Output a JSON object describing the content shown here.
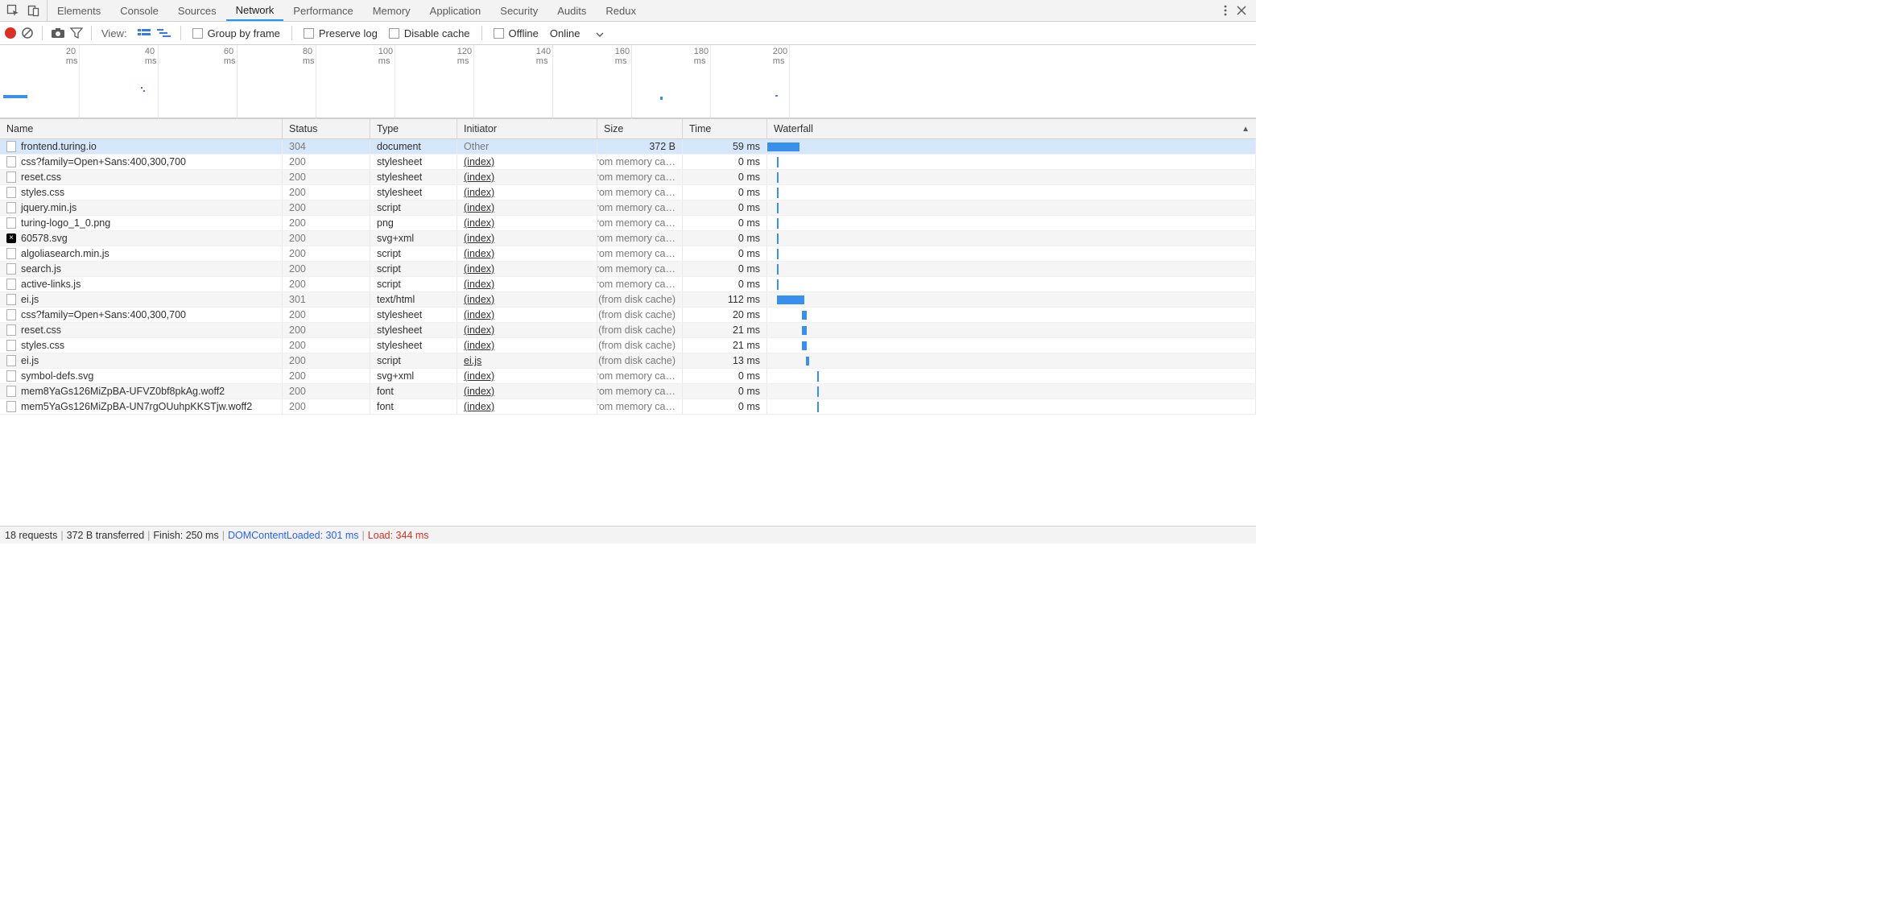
{
  "tabs": [
    "Elements",
    "Console",
    "Sources",
    "Network",
    "Performance",
    "Memory",
    "Application",
    "Security",
    "Audits",
    "Redux"
  ],
  "activeTab": "Network",
  "toolbar": {
    "viewLabel": "View:",
    "groupByFrame": "Group by frame",
    "preserveLog": "Preserve log",
    "disableCache": "Disable cache",
    "offline": "Offline",
    "online": "Online"
  },
  "overview": {
    "ticks": [
      "20 ms",
      "40 ms",
      "60 ms",
      "80 ms",
      "100 ms",
      "120 ms",
      "140 ms",
      "160 ms",
      "180 ms",
      "200 ms"
    ]
  },
  "columns": [
    "Name",
    "Status",
    "Type",
    "Initiator",
    "Size",
    "Time",
    "Waterfall"
  ],
  "rows": [
    {
      "name": "frontend.turing.io",
      "status": "304",
      "type": "document",
      "initiator": "Other",
      "initiatorLink": false,
      "size": "372 B",
      "sizeMuted": false,
      "time": "59 ms",
      "icon": "doc",
      "wf": {
        "start": 0,
        "width": 40,
        "thick": true
      }
    },
    {
      "name": "css?family=Open+Sans:400,300,700",
      "status": "200",
      "type": "stylesheet",
      "initiator": "(index)",
      "initiatorLink": true,
      "size": "(from memory ca…",
      "sizeMuted": true,
      "time": "0 ms",
      "icon": "doc",
      "wf": {
        "start": 12,
        "tick": true
      }
    },
    {
      "name": "reset.css",
      "status": "200",
      "type": "stylesheet",
      "initiator": "(index)",
      "initiatorLink": true,
      "size": "(from memory ca…",
      "sizeMuted": true,
      "time": "0 ms",
      "icon": "doc",
      "wf": {
        "start": 12,
        "tick": true
      }
    },
    {
      "name": "styles.css",
      "status": "200",
      "type": "stylesheet",
      "initiator": "(index)",
      "initiatorLink": true,
      "size": "(from memory ca…",
      "sizeMuted": true,
      "time": "0 ms",
      "icon": "doc",
      "wf": {
        "start": 12,
        "tick": true
      }
    },
    {
      "name": "jquery.min.js",
      "status": "200",
      "type": "script",
      "initiator": "(index)",
      "initiatorLink": true,
      "size": "(from memory ca…",
      "sizeMuted": true,
      "time": "0 ms",
      "icon": "doc",
      "wf": {
        "start": 12,
        "tick": true
      }
    },
    {
      "name": "turing-logo_1_0.png",
      "status": "200",
      "type": "png",
      "initiator": "(index)",
      "initiatorLink": true,
      "size": "(from memory ca…",
      "sizeMuted": true,
      "time": "0 ms",
      "icon": "doc",
      "wf": {
        "start": 12,
        "tick": true
      }
    },
    {
      "name": "60578.svg",
      "status": "200",
      "type": "svg+xml",
      "initiator": "(index)",
      "initiatorLink": true,
      "size": "(from memory ca…",
      "sizeMuted": true,
      "time": "0 ms",
      "icon": "svg-error",
      "wf": {
        "start": 12,
        "tick": true
      }
    },
    {
      "name": "algoliasearch.min.js",
      "status": "200",
      "type": "script",
      "initiator": "(index)",
      "initiatorLink": true,
      "size": "(from memory ca…",
      "sizeMuted": true,
      "time": "0 ms",
      "icon": "doc",
      "wf": {
        "start": 12,
        "tick": true
      }
    },
    {
      "name": "search.js",
      "status": "200",
      "type": "script",
      "initiator": "(index)",
      "initiatorLink": true,
      "size": "(from memory ca…",
      "sizeMuted": true,
      "time": "0 ms",
      "icon": "doc",
      "wf": {
        "start": 12,
        "tick": true
      }
    },
    {
      "name": "active-links.js",
      "status": "200",
      "type": "script",
      "initiator": "(index)",
      "initiatorLink": true,
      "size": "(from memory ca…",
      "sizeMuted": true,
      "time": "0 ms",
      "icon": "doc",
      "wf": {
        "start": 12,
        "tick": true
      }
    },
    {
      "name": "ei.js",
      "status": "301",
      "type": "text/html",
      "initiator": "(index)",
      "initiatorLink": true,
      "size": "(from disk cache)",
      "sizeMuted": true,
      "time": "112 ms",
      "icon": "doc",
      "wf": {
        "start": 12,
        "width": 34,
        "thick": true
      }
    },
    {
      "name": "css?family=Open+Sans:400,300,700",
      "status": "200",
      "type": "stylesheet",
      "initiator": "(index)",
      "initiatorLink": true,
      "size": "(from disk cache)",
      "sizeMuted": true,
      "time": "20 ms",
      "icon": "doc",
      "wf": {
        "start": 43,
        "width": 6,
        "thick": true
      }
    },
    {
      "name": "reset.css",
      "status": "200",
      "type": "stylesheet",
      "initiator": "(index)",
      "initiatorLink": true,
      "size": "(from disk cache)",
      "sizeMuted": true,
      "time": "21 ms",
      "icon": "doc",
      "wf": {
        "start": 43,
        "width": 6,
        "thick": true
      }
    },
    {
      "name": "styles.css",
      "status": "200",
      "type": "stylesheet",
      "initiator": "(index)",
      "initiatorLink": true,
      "size": "(from disk cache)",
      "sizeMuted": true,
      "time": "21 ms",
      "icon": "doc",
      "wf": {
        "start": 43,
        "width": 6,
        "thick": true
      }
    },
    {
      "name": "ei.js",
      "status": "200",
      "type": "script",
      "initiator": "ei.js",
      "initiatorLink": true,
      "size": "(from disk cache)",
      "sizeMuted": true,
      "time": "13 ms",
      "icon": "doc",
      "wf": {
        "start": 48,
        "width": 4,
        "thick": true
      }
    },
    {
      "name": "symbol-defs.svg",
      "status": "200",
      "type": "svg+xml",
      "initiator": "(index)",
      "initiatorLink": true,
      "size": "(from memory ca…",
      "sizeMuted": true,
      "time": "0 ms",
      "icon": "doc",
      "wf": {
        "start": 62,
        "tick": true
      }
    },
    {
      "name": "mem8YaGs126MiZpBA-UFVZ0bf8pkAg.woff2",
      "status": "200",
      "type": "font",
      "initiator": "(index)",
      "initiatorLink": true,
      "size": "(from memory ca…",
      "sizeMuted": true,
      "time": "0 ms",
      "icon": "doc",
      "wf": {
        "start": 62,
        "tick": true
      }
    },
    {
      "name": "mem5YaGs126MiZpBA-UN7rgOUuhpKKSTjw.woff2",
      "status": "200",
      "type": "font",
      "initiator": "(index)",
      "initiatorLink": true,
      "size": "(from memory ca…",
      "sizeMuted": true,
      "time": "0 ms",
      "icon": "doc",
      "wf": {
        "start": 62,
        "tick": true
      }
    }
  ],
  "statusBar": {
    "requests": "18 requests",
    "transferred": "372 B transferred",
    "finish": "Finish: 250 ms",
    "dcl": "DOMContentLoaded: 301 ms",
    "load": "Load: 344 ms"
  }
}
